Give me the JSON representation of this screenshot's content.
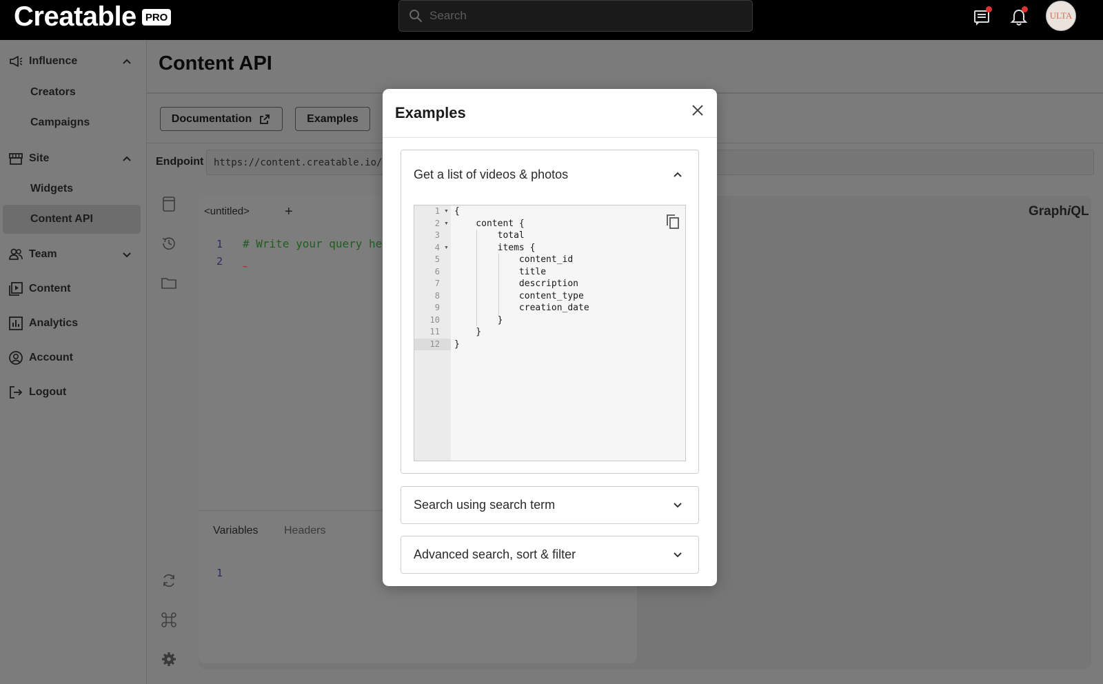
{
  "brand": {
    "name": "Creatable",
    "badge": "PRO"
  },
  "search": {
    "placeholder": "Search"
  },
  "avatar": {
    "text": "ULTA"
  },
  "sidebar": {
    "sections": [
      {
        "label": "Influence",
        "items": [
          "Creators",
          "Campaigns"
        ]
      },
      {
        "label": "Site",
        "items": [
          "Widgets",
          "Content API"
        ]
      },
      {
        "label": "Team"
      },
      {
        "label": "Content"
      },
      {
        "label": "Analytics"
      },
      {
        "label": "Account"
      },
      {
        "label": "Logout"
      }
    ],
    "active_item": "Content API"
  },
  "page": {
    "title": "Content API",
    "buttons": {
      "documentation": "Documentation",
      "examples": "Examples"
    },
    "endpoint_label": "Endpoint",
    "endpoint_value": "https://content.creatable.io/"
  },
  "graphiql": {
    "tab": "<untitled>",
    "add": "+",
    "brand_prefix": "Graph",
    "brand_i": "i",
    "brand_suffix": "QL",
    "editor_line_numbers": [
      "1",
      "2"
    ],
    "editor_comment": "# Write your query he",
    "variables_tab": "Variables",
    "headers_tab": "Headers",
    "variables_line": "1"
  },
  "modal": {
    "title": "Examples",
    "accordions": [
      {
        "label": "Get a list of videos & photos",
        "expanded": true
      },
      {
        "label": "Search using search term",
        "expanded": false
      },
      {
        "label": "Advanced search, sort & filter",
        "expanded": false
      }
    ],
    "code_line_numbers": [
      "1",
      "2",
      "3",
      "4",
      "5",
      "6",
      "7",
      "8",
      "9",
      "10",
      "11",
      "12"
    ],
    "code_lines": [
      "{",
      "    content {",
      "        total",
      "        items {",
      "            content_id",
      "            title",
      "            description",
      "            content_type",
      "            creation_date",
      "        }",
      "    }",
      "}"
    ]
  },
  "colors": {
    "overlay": "#7b7b7b",
    "topbar": "#000000",
    "modal": "#ffffff",
    "notification_dot": "#dd3333"
  }
}
